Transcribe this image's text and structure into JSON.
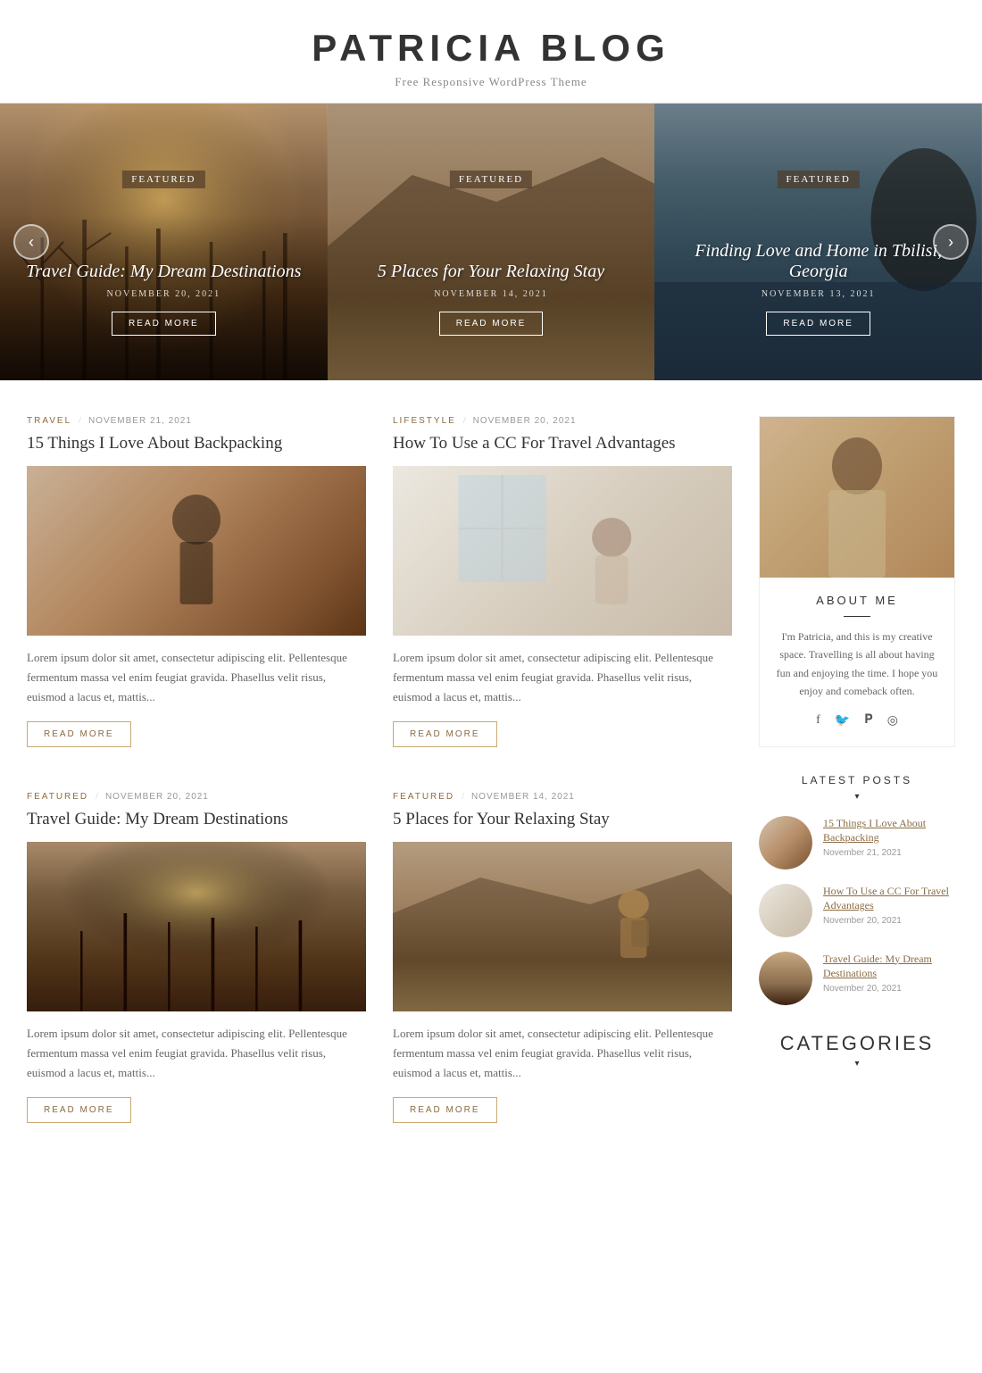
{
  "site": {
    "title": "PATRICIA BLOG",
    "tagline": "Free Responsive WordPress Theme"
  },
  "slider": {
    "prev_label": "‹",
    "next_label": "›",
    "slides": [
      {
        "badge": "FEATURED",
        "title": "Travel Guide: My Dream Destinations",
        "date": "NOVEMBER 20, 2021",
        "btn_label": "READ MORE",
        "bg_class": "slide-1-bg"
      },
      {
        "badge": "FEATURED",
        "title": "5 Places for Your Relaxing Stay",
        "date": "NOVEMBER 14, 2021",
        "btn_label": "READ MORE",
        "bg_class": "slide-2-bg"
      },
      {
        "badge": "FEATURED",
        "title": "Finding Love and Home in Tbilisi, Georgia",
        "date": "NOVEMBER 13, 2021",
        "btn_label": "READ MORE",
        "bg_class": "slide-3-bg"
      }
    ]
  },
  "posts": [
    {
      "category": "TRAVEL",
      "date": "NOVEMBER 21, 2021",
      "title": "15 Things I Love About Backpacking",
      "excerpt": "Lorem ipsum dolor sit amet, consectetur adipiscing elit. Pellentesque fermentum massa vel enim feugiat gravida. Phasellus velit risus, euismod a lacus et, mattis...",
      "btn_label": "READ MORE",
      "img_class": "img-backpacking"
    },
    {
      "category": "LIFESTYLE",
      "date": "NOVEMBER 20, 2021",
      "title": "How To Use a CC For Travel Advantages",
      "excerpt": "Lorem ipsum dolor sit amet, consectetur adipiscing elit. Pellentesque fermentum massa vel enim feugiat gravida. Phasellus velit risus, euismod a lacus et, mattis...",
      "btn_label": "READ MORE",
      "img_class": "img-cc"
    },
    {
      "category": "FEATURED",
      "date": "NOVEMBER 20, 2021",
      "title": "Travel Guide: My Dream Destinations",
      "excerpt": "Lorem ipsum dolor sit amet, consectetur adipiscing elit. Pellentesque fermentum massa vel enim feugiat gravida. Phasellus velit risus, euismod a lacus et, mattis...",
      "btn_label": "READ MORE",
      "img_class": "img-travel-guide"
    },
    {
      "category": "FEATURED",
      "date": "NOVEMBER 14, 2021",
      "title": "5 Places for Your Relaxing Stay",
      "excerpt": "Lorem ipsum dolor sit amet, consectetur adipiscing elit. Pellentesque fermentum massa vel enim feugiat gravida. Phasellus velit risus, euismod a lacus et, mattis...",
      "btn_label": "READ MORE",
      "img_class": "img-relaxing"
    }
  ],
  "sidebar": {
    "about": {
      "title": "ABOUT ME",
      "text": "I'm Patricia, and this is my creative space. Travelling is all about having fun and enjoying the time. I hope you enjoy and comeback often.",
      "social": [
        "f",
        "𝕥",
        "𝕡",
        "◉"
      ]
    },
    "latest_posts": {
      "title": "LATEST POSTS",
      "arrow": "▾",
      "items": [
        {
          "title": "15 Things I Love About Backpacking",
          "date": "November 21, 2021",
          "img_class": "img-backpacking"
        },
        {
          "title": "How To Use a CC For Travel Advantages",
          "date": "November 20, 2021",
          "img_class": "img-cc"
        },
        {
          "title": "Travel Guide: My Dream Destinations",
          "date": "November 20, 2021",
          "img_class": "img-travel-guide"
        }
      ]
    },
    "categories": {
      "title": "CATEGORIES",
      "arrow": "▾"
    }
  }
}
